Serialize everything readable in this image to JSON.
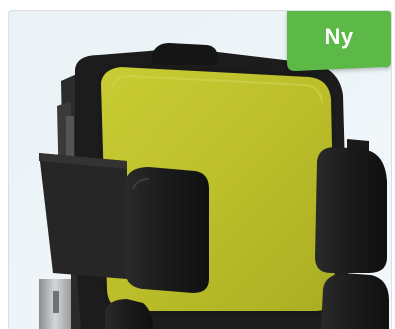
{
  "badge": {
    "label": "Ny",
    "color": "#5cb947"
  },
  "image": {
    "subject": "seat-backrest-with-lateral-supports",
    "colors": {
      "cushion": "#bdbf2a",
      "frame": "#1e1e1e",
      "background": "#eef4f7"
    }
  }
}
